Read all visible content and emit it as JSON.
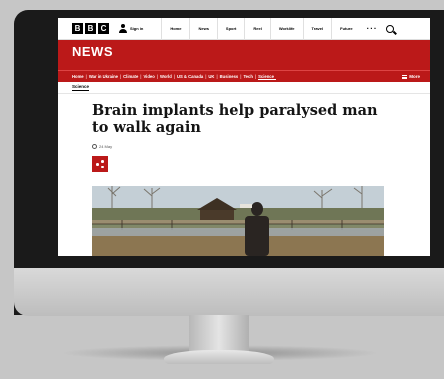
{
  "bbc": {
    "logo_letters": [
      "B",
      "B",
      "C"
    ],
    "signin_label": "Sign in",
    "nav_items": [
      "Home",
      "News",
      "Sport",
      "Reel",
      "Worklife",
      "Travel",
      "Future"
    ],
    "more_label": "···"
  },
  "news": {
    "title": "NEWS",
    "sections": [
      "Home",
      "War in Ukraine",
      "Climate",
      "Video",
      "World",
      "US & Canada",
      "UK",
      "Business",
      "Tech",
      "Science"
    ],
    "active_section": "Science",
    "more_label": "More"
  },
  "subnav": {
    "label": "Science"
  },
  "article": {
    "headline": "Brain implants help paralysed man to walk again",
    "date": "24 May"
  },
  "colors": {
    "bbc_red": "#bb1919",
    "monitor_bezel": "#1a1a1a",
    "background": "#c6c6c6"
  },
  "icons": [
    "person-icon",
    "search-icon",
    "hamburger-icon",
    "clock-icon",
    "share-icon"
  ]
}
